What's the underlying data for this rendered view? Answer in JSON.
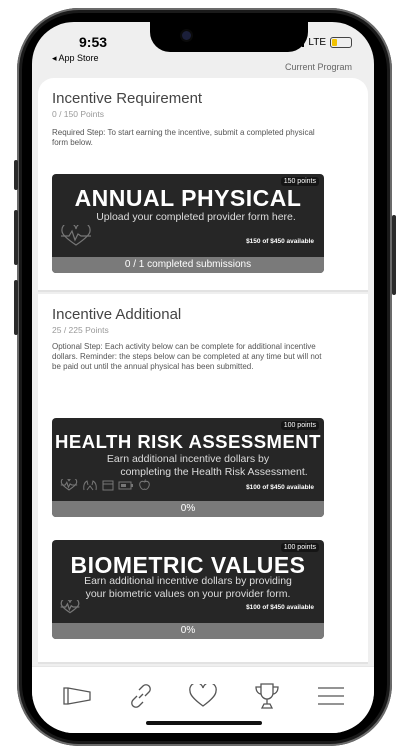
{
  "status": {
    "time": "9:53",
    "back_app": "◂ App Store",
    "network": "LTE"
  },
  "header": {
    "program_label": "Current Program"
  },
  "incentive_requirement": {
    "title": "Incentive Requirement",
    "points": "0 / 150 Points",
    "description": "Required Step: To start earning the incentive, submit a completed physical form below.",
    "activity": {
      "points_badge": "150 points",
      "title": "ANNUAL PHYSICAL",
      "subtitle": "Upload your completed provider form here.",
      "available": "$150 of $450 available",
      "progress_text": "0 / 1 completed submissions",
      "icons": [
        "heartbeat-icon"
      ]
    }
  },
  "incentive_additional": {
    "title": "Incentive Additional",
    "points": "25 / 225 Points",
    "description": "Optional Step: Each activity below can be complete for additional incentive dollars. Reminder: the steps below can be completed at any time but will not be paid out until the annual physical has been submitted.",
    "activities": [
      {
        "points_badge": "100 points",
        "title": "HEALTH RISK ASSESSMENT",
        "subtitle_line1": "Earn additional incentive dollars by",
        "subtitle_line2": "completing the Health Risk Assessment.",
        "available": "$100 of $450 available",
        "progress_text": "0%",
        "icons": [
          "heartbeat-icon",
          "hands-icon",
          "calendar-icon",
          "battery-icon",
          "apple-icon"
        ]
      },
      {
        "points_badge": "100 points",
        "title": "BIOMETRIC VALUES",
        "subtitle_line1": "Earn additional incentive dollars by providing",
        "subtitle_line2": "your biometric values on your provider form.",
        "available": "$100 of $450 available",
        "progress_text": "0%",
        "icons": [
          "heartbeat-icon"
        ]
      }
    ]
  },
  "tabbar": {
    "items": [
      "megaphone-icon",
      "link-icon",
      "heart-icon",
      "trophy-icon",
      "menu-icon"
    ],
    "color": "#555555"
  },
  "colors": {
    "banner_bg": "#262626",
    "progress_bg": "#7a7a7a",
    "page_bg": "#efefef"
  }
}
